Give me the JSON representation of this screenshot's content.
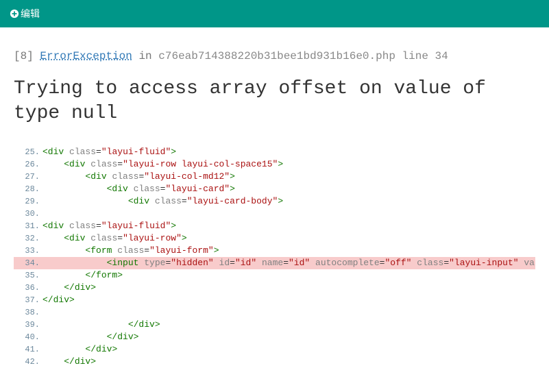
{
  "header": {
    "edit_label": "编辑"
  },
  "error": {
    "code": "[8]",
    "class": "ErrorException",
    "in": "in",
    "file": "c76eab714388220b31bee1bd931b16e0.php",
    "line_label": "line",
    "line": "34",
    "message": "Trying to access array offset on value of type null"
  },
  "code_lines": [
    {
      "n": "25.",
      "indent": 0,
      "text": "<div class=\"layui-fluid\">"
    },
    {
      "n": "26.",
      "indent": 1,
      "text": "<div class=\"layui-row layui-col-space15\">"
    },
    {
      "n": "27.",
      "indent": 2,
      "text": "<div class=\"layui-col-md12\">"
    },
    {
      "n": "28.",
      "indent": 3,
      "text": "<div class=\"layui-card\">"
    },
    {
      "n": "29.",
      "indent": 4,
      "text": "<div class=\"layui-card-body\">"
    },
    {
      "n": "30.",
      "indent": 0,
      "text": ""
    },
    {
      "n": "31.",
      "indent": 0,
      "text": "<div class=\"layui-fluid\">"
    },
    {
      "n": "32.",
      "indent": 1,
      "text": "<div class=\"layui-row\">"
    },
    {
      "n": "33.",
      "indent": 2,
      "text": "<form class=\"layui-form\">"
    },
    {
      "n": "34.",
      "indent": 3,
      "text": "<input type=\"hidden\" id=\"id\" name=\"id\" autocomplete=\"off\" class=\"layui-input\" value=",
      "hl": true
    },
    {
      "n": "35.",
      "indent": 2,
      "text": "</form>"
    },
    {
      "n": "36.",
      "indent": 1,
      "text": "</div>"
    },
    {
      "n": "37.",
      "indent": 0,
      "text": "</div>"
    },
    {
      "n": "38.",
      "indent": 0,
      "text": ""
    },
    {
      "n": "39.",
      "indent": 4,
      "text": "</div>"
    },
    {
      "n": "40.",
      "indent": 3,
      "text": "</div>"
    },
    {
      "n": "41.",
      "indent": 2,
      "text": "</div>"
    },
    {
      "n": "42.",
      "indent": 1,
      "text": "</div>"
    }
  ]
}
